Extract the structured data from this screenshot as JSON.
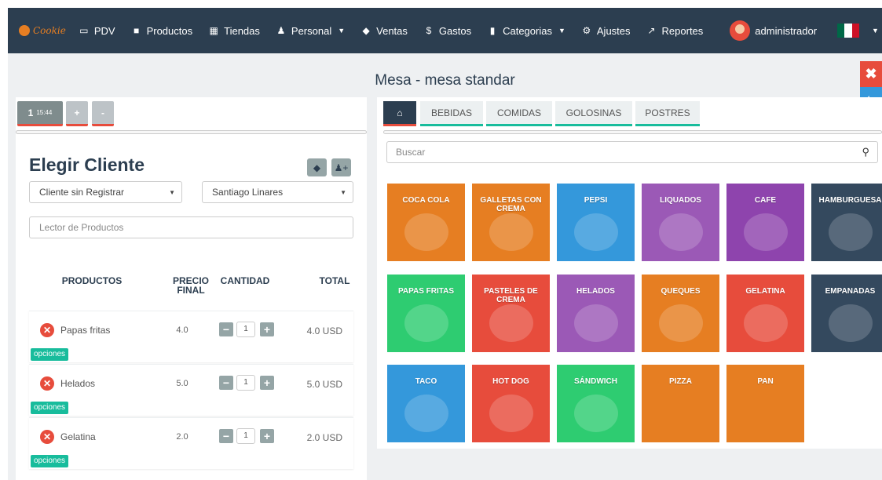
{
  "nav": {
    "brand": "Cookie",
    "items": [
      {
        "label": "PDV",
        "icon": "card-icon",
        "glyph": "▭"
      },
      {
        "label": "Productos",
        "icon": "box-icon",
        "glyph": "■"
      },
      {
        "label": "Tiendas",
        "icon": "building-icon",
        "glyph": "▦"
      },
      {
        "label": "Personal",
        "icon": "users-icon",
        "glyph": "♟"
      },
      {
        "label": "Ventas",
        "icon": "tag-icon",
        "glyph": "◆"
      },
      {
        "label": "Gastos",
        "icon": "dollar-icon",
        "glyph": "$"
      },
      {
        "label": "Categorias",
        "icon": "bookmark-icon",
        "glyph": "▮"
      },
      {
        "label": "Ajustes",
        "icon": "cogs-icon",
        "glyph": "⚙"
      },
      {
        "label": "Reportes",
        "icon": "chart-icon",
        "glyph": "↗"
      }
    ],
    "user": "administrador",
    "flag_colors": [
      "#006847",
      "#ffffff",
      "#ce1126"
    ]
  },
  "page_title": "Mesa - mesa standar",
  "side_actions": [
    {
      "icon": "close-icon",
      "glyph": "✖",
      "color": "#e74c3c"
    },
    {
      "icon": "back-arrow-icon",
      "glyph": "⬅",
      "color": "#3498db"
    },
    {
      "icon": "utensils-icon",
      "glyph": "🍴",
      "color": "#f39c12"
    }
  ],
  "order_tabs": {
    "active_number": "1",
    "active_time": "15:44",
    "add": "+",
    "remove": "-"
  },
  "client": {
    "title": "Elegir Cliente",
    "client_select": "Cliente sin Registrar",
    "waiter_select": "Santiago Linares",
    "scanner_placeholder": "Lector de Productos"
  },
  "table": {
    "headers": {
      "product": "PRODUCTOS",
      "price_line1": "PRECIO",
      "price_line2": "FINAL",
      "qty": "CANTIDAD",
      "total": "TOTAL"
    },
    "rows": [
      {
        "name": "Papas fritas",
        "price": "4.0",
        "qty": "1",
        "total": "4.0 USD",
        "options": "opciones"
      },
      {
        "name": "Helados",
        "price": "5.0",
        "qty": "1",
        "total": "5.0 USD",
        "options": "opciones"
      },
      {
        "name": "Gelatina",
        "price": "2.0",
        "qty": "1",
        "total": "2.0 USD",
        "options": "opciones"
      }
    ]
  },
  "categories": {
    "home_icon": "home-icon",
    "tabs": [
      "BEBIDAS",
      "COMIDAS",
      "GOLOSINAS",
      "POSTRES"
    ],
    "search_placeholder": "Buscar"
  },
  "products": [
    {
      "label": "COCA COLA",
      "color": "#e67e22"
    },
    {
      "label": "GALLETAS CON CREMA",
      "color": "#e67e22"
    },
    {
      "label": "PEPSI",
      "color": "#3498db"
    },
    {
      "label": "LIQUADOS",
      "color": "#9b59b6"
    },
    {
      "label": "CAFE",
      "color": "#8e44ad"
    },
    {
      "label": "HAMBURGUESA",
      "color": "#34495e"
    },
    {
      "label": "PAPAS FRITAS",
      "color": "#2ecc71"
    },
    {
      "label": "PASTELES DE CREMA",
      "color": "#e74c3c"
    },
    {
      "label": "HELADOS",
      "color": "#9b59b6"
    },
    {
      "label": "QUEQUES",
      "color": "#e67e22"
    },
    {
      "label": "GELATINA",
      "color": "#e74c3c"
    },
    {
      "label": "EMPANADAS",
      "color": "#34495e"
    },
    {
      "label": "TACO",
      "color": "#3498db"
    },
    {
      "label": "HOT DOG",
      "color": "#e74c3c"
    },
    {
      "label": "SÁNDWICH",
      "color": "#2ecc71"
    },
    {
      "label": "PIZZA",
      "color": "#e67e22"
    },
    {
      "label": "PAN",
      "color": "#e67e22"
    }
  ]
}
